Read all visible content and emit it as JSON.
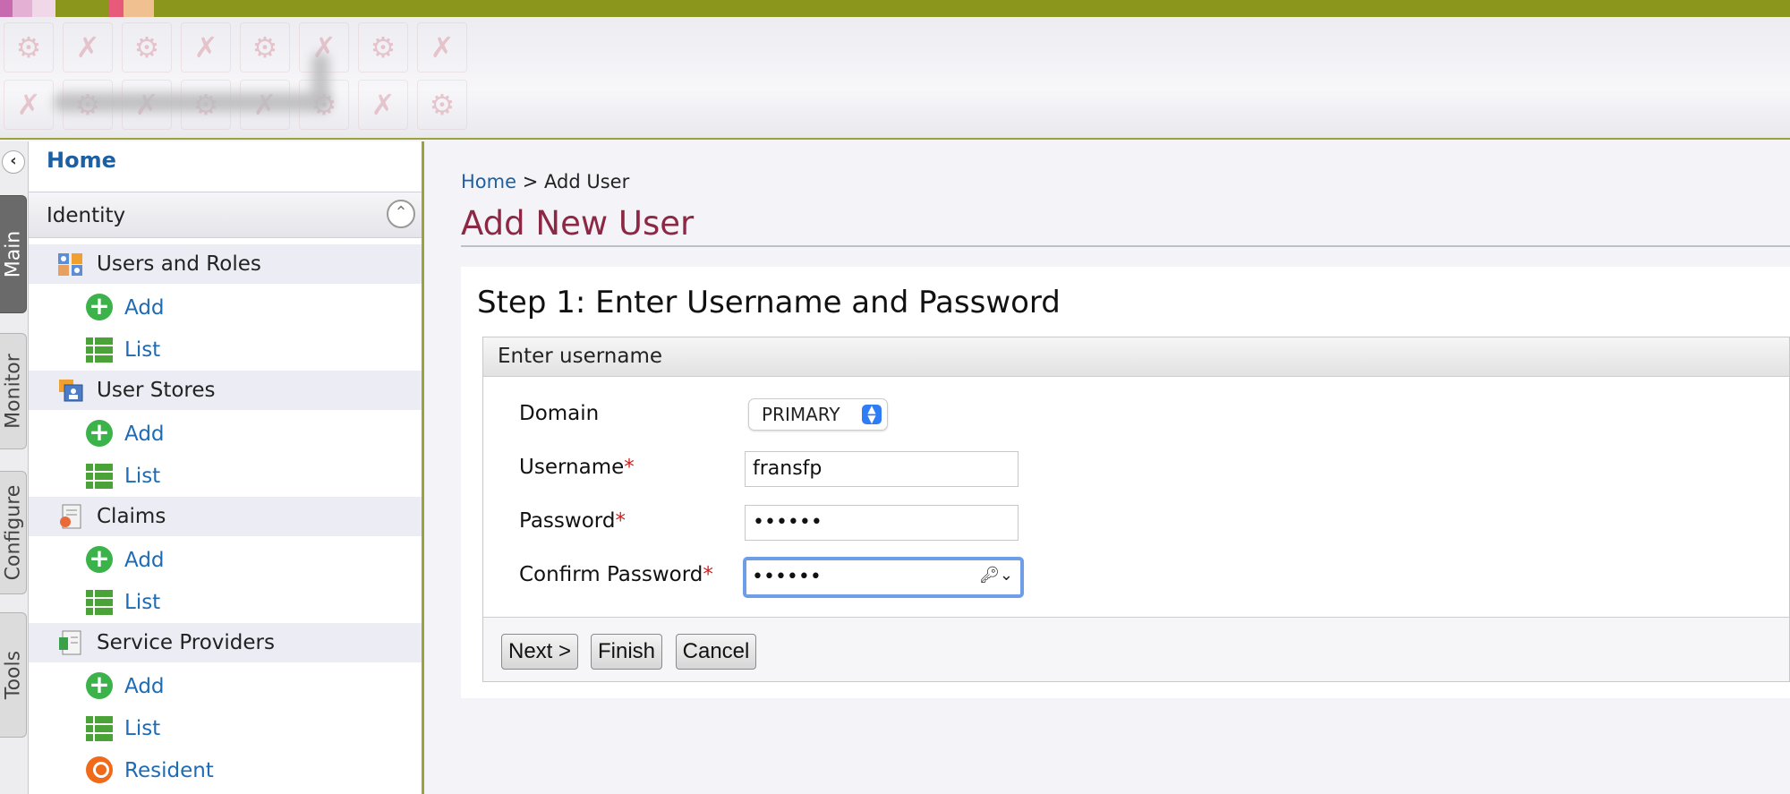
{
  "header": {
    "colors": {
      "topbar": "#8b961c",
      "title": "#8c2744",
      "link": "#1d6bb5",
      "accent": "#9aa23a"
    },
    "top_swatches": [
      "#c86ab0",
      "#e4b0d4",
      "#f0d8e8",
      "#e85a7a",
      "#f0c090"
    ],
    "logo_tiles": [
      "gear-icon",
      "tools-icon",
      "gear-icon",
      "tools-icon",
      "gear-icon",
      "tools-icon",
      "gear-icon",
      "tools-icon"
    ]
  },
  "vtabs": {
    "collapse_symbol": "‹",
    "items": [
      {
        "label": "Main",
        "active": true
      },
      {
        "label": "Monitor",
        "active": false
      },
      {
        "label": "Configure",
        "active": false
      },
      {
        "label": "Tools",
        "active": false
      }
    ]
  },
  "sidebar": {
    "home_label": "Home",
    "section_label": "Identity",
    "section_toggle_symbol": "⌃",
    "groups": [
      {
        "label": "Users and Roles",
        "icon": "users-roles-icon",
        "items": [
          {
            "label": "Add",
            "icon": "add-icon"
          },
          {
            "label": "List",
            "icon": "list-icon"
          }
        ]
      },
      {
        "label": "User Stores",
        "icon": "user-stores-icon",
        "items": [
          {
            "label": "Add",
            "icon": "add-icon"
          },
          {
            "label": "List",
            "icon": "list-icon"
          }
        ]
      },
      {
        "label": "Claims",
        "icon": "claims-icon",
        "items": [
          {
            "label": "Add",
            "icon": "add-icon"
          },
          {
            "label": "List",
            "icon": "list-icon"
          }
        ]
      },
      {
        "label": "Service Providers",
        "icon": "service-providers-icon",
        "items": [
          {
            "label": "Add",
            "icon": "add-icon"
          },
          {
            "label": "List",
            "icon": "list-icon"
          },
          {
            "label": "Resident",
            "icon": "resident-icon"
          }
        ]
      }
    ]
  },
  "main": {
    "breadcrumb": {
      "home": "Home",
      "separator": ">",
      "current": "Add User"
    },
    "page_title": "Add New User",
    "step_title": "Step 1: Enter Username and Password",
    "fieldset_legend": "Enter username",
    "form": {
      "domain_label": "Domain",
      "domain_value": "PRIMARY",
      "username_label": "Username",
      "username_value": "fransfp",
      "password_label": "Password",
      "password_value": "••••••",
      "confirm_label": "Confirm Password",
      "confirm_value": "••••••",
      "required_marker": "*",
      "password_manager_icon": "🔑︎⌄"
    },
    "buttons": {
      "next": "Next >",
      "finish": "Finish",
      "cancel": "Cancel"
    }
  }
}
